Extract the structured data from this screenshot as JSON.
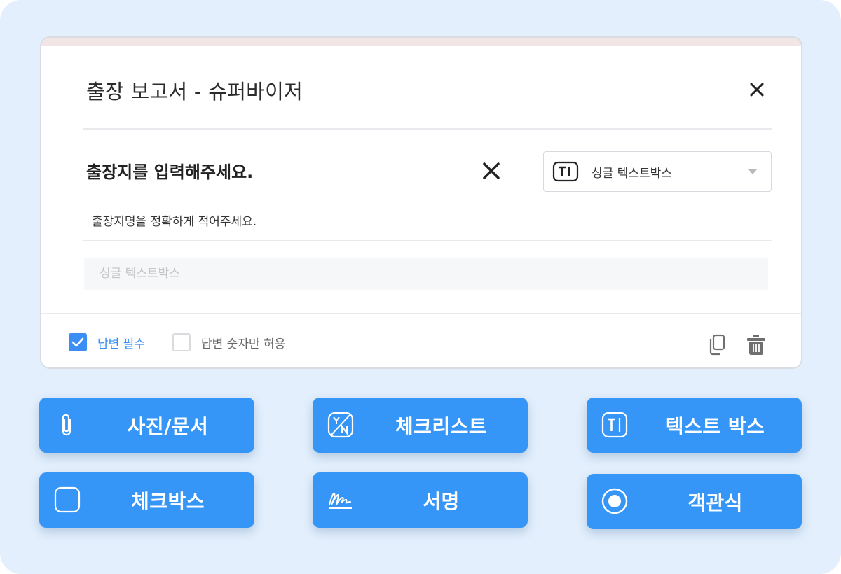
{
  "dialog": {
    "title": "출장 보고서 - 슈퍼바이저"
  },
  "question": {
    "label": "출장지를 입력해주세요.",
    "description": "출장지명을 정확하게 적어주세요.",
    "type_select": {
      "selected": "싱글 텍스트박스",
      "icon": "text-box-icon"
    },
    "answer_placeholder": "싱글 텍스트박스"
  },
  "options": {
    "required": {
      "label": "답변 필수",
      "checked": true
    },
    "numbers_only": {
      "label": "답변 숫자만 허용",
      "checked": false
    }
  },
  "toolbar": [
    {
      "label": "사진/문서",
      "icon": "paperclip-icon"
    },
    {
      "label": "체크리스트",
      "icon": "yes-no-icon"
    },
    {
      "label": "텍스트 박스",
      "icon": "text-box-icon"
    },
    {
      "label": "체크박스",
      "icon": "checkbox-icon"
    },
    {
      "label": "서명",
      "icon": "signature-icon"
    },
    {
      "label": "객관식",
      "icon": "radio-icon"
    }
  ],
  "colors": {
    "accent": "#3596f8",
    "checkbox_on": "#3a8ef6",
    "required_text": "#3a8ef6",
    "background": "#e3effc"
  }
}
